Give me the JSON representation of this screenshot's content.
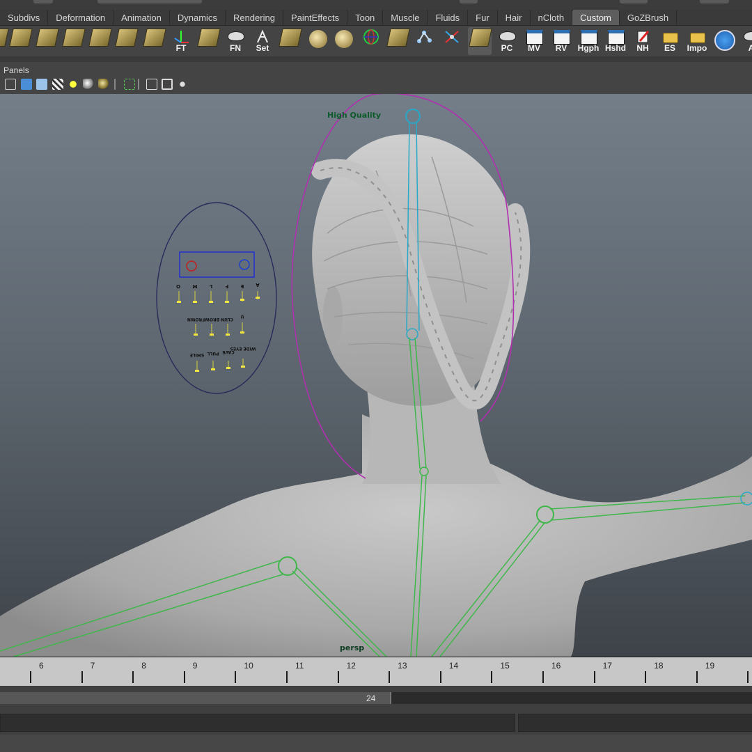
{
  "menu_tabs": [
    "Subdivs",
    "Deformation",
    "Animation",
    "Dynamics",
    "Rendering",
    "PaintEffects",
    "Toon",
    "Muscle",
    "Fluids",
    "Fur",
    "Hair",
    "nCloth",
    "Custom",
    "GoZBrush"
  ],
  "active_tab": "Custom",
  "shelf": {
    "labeled": {
      "ft": "FT",
      "fn": "FN",
      "set": "Set",
      "pc": "PC",
      "mv": "MV",
      "rv": "RV",
      "hgph": "Hgph",
      "hshd": "Hshd",
      "nh": "NH",
      "es": "ES",
      "impo": "Impo",
      "a": "A"
    }
  },
  "panels_label": "Panels",
  "viewport": {
    "quality_label": "High Quality",
    "camera_label": "persp"
  },
  "facial_panel": {
    "top_letters": [
      "O",
      "M",
      "L",
      "F",
      "E",
      "A"
    ],
    "mid_labels": [
      "BROWFROWN",
      "EAR",
      "LU"
    ],
    "mid_labels_2": [
      "BROWFROWN",
      "CLUN",
      "U"
    ],
    "bottom_labels": [
      "SMILE",
      "PULL",
      "CAVE",
      "WIDE EYES"
    ],
    "colors": {
      "outline": "#2a2a5a",
      "box": "#2030d0",
      "left_circle": "#c02020",
      "right_circle": "#2040d0",
      "knob": "#f2e640"
    }
  },
  "timeline": {
    "ticks": [
      "6",
      "7",
      "8",
      "9",
      "10",
      "11",
      "12",
      "13",
      "14",
      "15",
      "16",
      "17",
      "18",
      "19"
    ]
  },
  "range": {
    "end_value": "24"
  },
  "colors": {
    "active_tab": "#5d5d5d",
    "rig_green": "#3fb74a",
    "rig_cyan": "#28a8c8",
    "hq_curve": "#b030b0"
  }
}
